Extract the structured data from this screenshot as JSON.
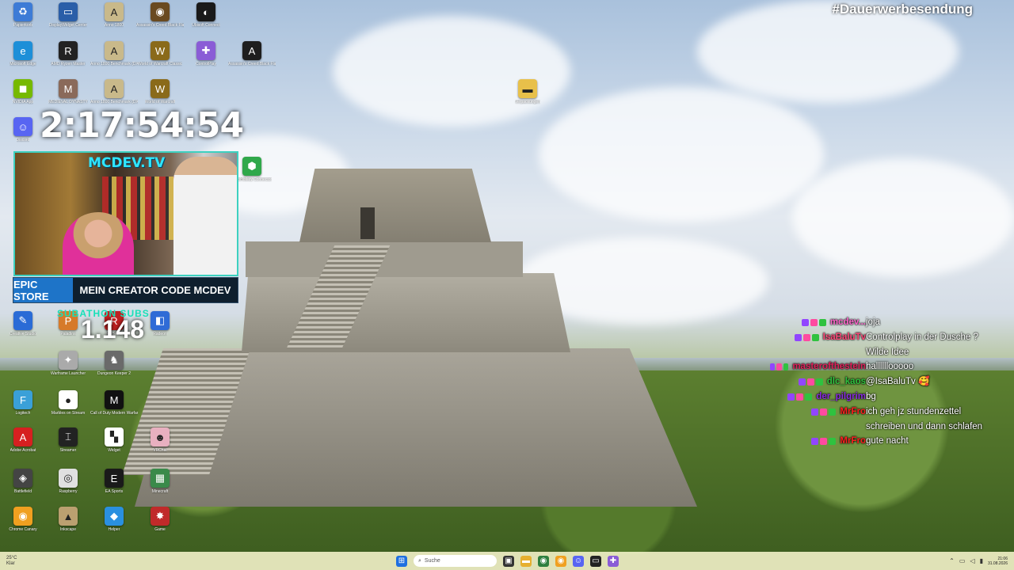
{
  "overlay": {
    "hashtag": "#Dauerwerbesendung",
    "timer": "2:17:54:54",
    "subathon_label": "SUBATHON SUBS",
    "subathon_count": "1.148"
  },
  "webcam": {
    "channel_title": "MCDEV.TV",
    "epic_label": "EPIC STORE",
    "creator_code": "MEIN CREATOR CODE MCDEV"
  },
  "desktop_icons": [
    {
      "label": "Papierkorb",
      "name": "recycle-bin-icon",
      "color": "#3d7bd6",
      "glyph": "♻"
    },
    {
      "label": "DisplayWidget Center",
      "name": "display-widget-icon",
      "color": "#2a5ea8",
      "glyph": "▭"
    },
    {
      "label": "Anno 1800",
      "name": "anno-1800-icon",
      "color": "#c9b98a",
      "glyph": "A"
    },
    {
      "label": "Assassin's Creed Black Flag Legacy",
      "name": "assassins-creed-icon",
      "color": "#6a4a20",
      "glyph": "◉"
    },
    {
      "label": "Ubisoft Connect",
      "name": "ubisoft-icon",
      "color": "#1a1a1a",
      "glyph": "◐"
    },
    {
      "label": "Microsoft Edge",
      "name": "edge-icon",
      "color": "#1d8fd8",
      "glyph": "e"
    },
    {
      "label": "AMD Ryzen Master",
      "name": "ryzen-master-icon",
      "color": "#222",
      "glyph": "R"
    },
    {
      "label": "Anno 1800 Benchmark (DX11)",
      "name": "anno-benchmark-icon",
      "color": "#c9b98a",
      "glyph": "A"
    },
    {
      "label": "World of Warcraft Classic",
      "name": "wow-classic-icon",
      "color": "#8a6a1a",
      "glyph": "W"
    },
    {
      "label": "ControlPlay",
      "name": "controlplay-icon",
      "color": "#8a5cd6",
      "glyph": "✚"
    },
    {
      "label": "Assassin's Creed Black Flag Resynced",
      "name": "ac-resynced-icon",
      "color": "#1e1e1e",
      "glyph": "A"
    },
    {
      "label": "NVIDIA App",
      "name": "nvidia-icon",
      "color": "#76b900",
      "glyph": "◼"
    },
    {
      "label": "MEDIEVAL DYNASTY",
      "name": "medieval-icon",
      "color": "#8a6a5a",
      "glyph": "M"
    },
    {
      "label": "Anno 1800 Benchmark (DX12)",
      "name": "anno-dx12-icon",
      "color": "#c9b98a",
      "glyph": "A"
    },
    {
      "label": "World of Warcraft",
      "name": "wow-icon",
      "color": "#8a6a1a",
      "glyph": "W"
    },
    {
      "label": "Verpackungen",
      "name": "folder-icon",
      "color": "#e8c04a",
      "glyph": "▬"
    },
    {
      "label": "Discord",
      "name": "discord-icon",
      "color": "#5865f2",
      "glyph": "☺"
    },
    {
      "label": "AutoHotkey Connector",
      "name": "green-hex-icon",
      "color": "#2fa84a",
      "glyph": "⬢"
    },
    {
      "label": "Creative Studio",
      "name": "creative-studio-icon",
      "color": "#2a6bd6",
      "glyph": "✎"
    },
    {
      "label": "Paladins",
      "name": "paladins-icon",
      "color": "#d67a2a",
      "glyph": "P"
    },
    {
      "label": "RGBeatz",
      "name": "rgbeatz-icon",
      "color": "#c02020",
      "glyph": "R"
    },
    {
      "label": "Radeon",
      "name": "radeon-icon",
      "color": "#2f6bd6",
      "glyph": "◧"
    },
    {
      "label": "Warframe Launcher",
      "name": "warframe-icon",
      "color": "#aaaaaa",
      "glyph": "✦"
    },
    {
      "label": "Dungeon Keeper 2",
      "name": "dungeon-keeper-icon",
      "color": "#6a6a6a",
      "glyph": "♞"
    },
    {
      "label": "Logitech",
      "name": "logitech-icon",
      "color": "#3aa0d8",
      "glyph": "F"
    },
    {
      "label": "Marbles on Stream",
      "name": "marbles-icon",
      "color": "#ffffff",
      "glyph": "●"
    },
    {
      "label": "Call of Duty Modern Warfare",
      "name": "cod-icon",
      "color": "#111",
      "glyph": "M"
    },
    {
      "label": "Adobe Acrobat",
      "name": "acrobat-icon",
      "color": "#d62020",
      "glyph": "A"
    },
    {
      "label": "Streamer",
      "name": "streamer-icon",
      "color": "#222",
      "glyph": "⌶"
    },
    {
      "label": "Widget",
      "name": "widget-icon",
      "color": "#ffffff",
      "glyph": "▚"
    },
    {
      "label": "VRChat",
      "name": "vtuber-icon",
      "color": "#e8b0c0",
      "glyph": "☻"
    },
    {
      "label": "Battlefield",
      "name": "battlefield-icon",
      "color": "#444",
      "glyph": "◈"
    },
    {
      "label": "Raspberry",
      "name": "target-icon",
      "color": "#e0e0e0",
      "glyph": "◎"
    },
    {
      "label": "EA Sports",
      "name": "ea-icon",
      "color": "#1a1a1a",
      "glyph": "E"
    },
    {
      "label": "Minecraft",
      "name": "minecraft-icon",
      "color": "#3a8a4a",
      "glyph": "▦"
    },
    {
      "label": "Chrome Canary",
      "name": "chrome-canary-icon",
      "color": "#f0a020",
      "glyph": "◉"
    },
    {
      "label": "Inkscape",
      "name": "inkscape-icon",
      "color": "#bba070",
      "glyph": "▲"
    },
    {
      "label": "Helper",
      "name": "helper-icon",
      "color": "#2a90e0",
      "glyph": "◆"
    },
    {
      "label": "Game",
      "name": "game-icon",
      "color": "#c02a2a",
      "glyph": "✸"
    }
  ],
  "chat": [
    {
      "user": "mcdev...",
      "color": "#ff66cc",
      "text": "joja"
    },
    {
      "user": "IsaBaluTv",
      "color": "#ff4a7a",
      "text": "Controlplay in der Dusche ?"
    },
    {
      "user": "",
      "color": "#ffffff",
      "text": "Wilde Idee"
    },
    {
      "user": "masterofthestein",
      "color": "#e0205a",
      "text": "hallllllooooo"
    },
    {
      "user": "dlc_kaos",
      "color": "#2fc23f",
      "text": "@IsaBaluTv 🥰"
    },
    {
      "user": "der_pilgrim",
      "color": "#8a2be2",
      "text": "bg"
    },
    {
      "user": "MrFro",
      "color": "#ff2020",
      "text": "ich geh jz stundenzettel"
    },
    {
      "user": "",
      "color": "#ffffff",
      "text": "schreiben und dann schlafen"
    },
    {
      "user": "MrFro",
      "color": "#ff2020",
      "text": "gute nacht"
    }
  ],
  "taskbar": {
    "weather_temp": "25°C",
    "weather_desc": "Klar",
    "search_placeholder": "Suche",
    "time": "21:06",
    "date": "31.08.2026"
  }
}
